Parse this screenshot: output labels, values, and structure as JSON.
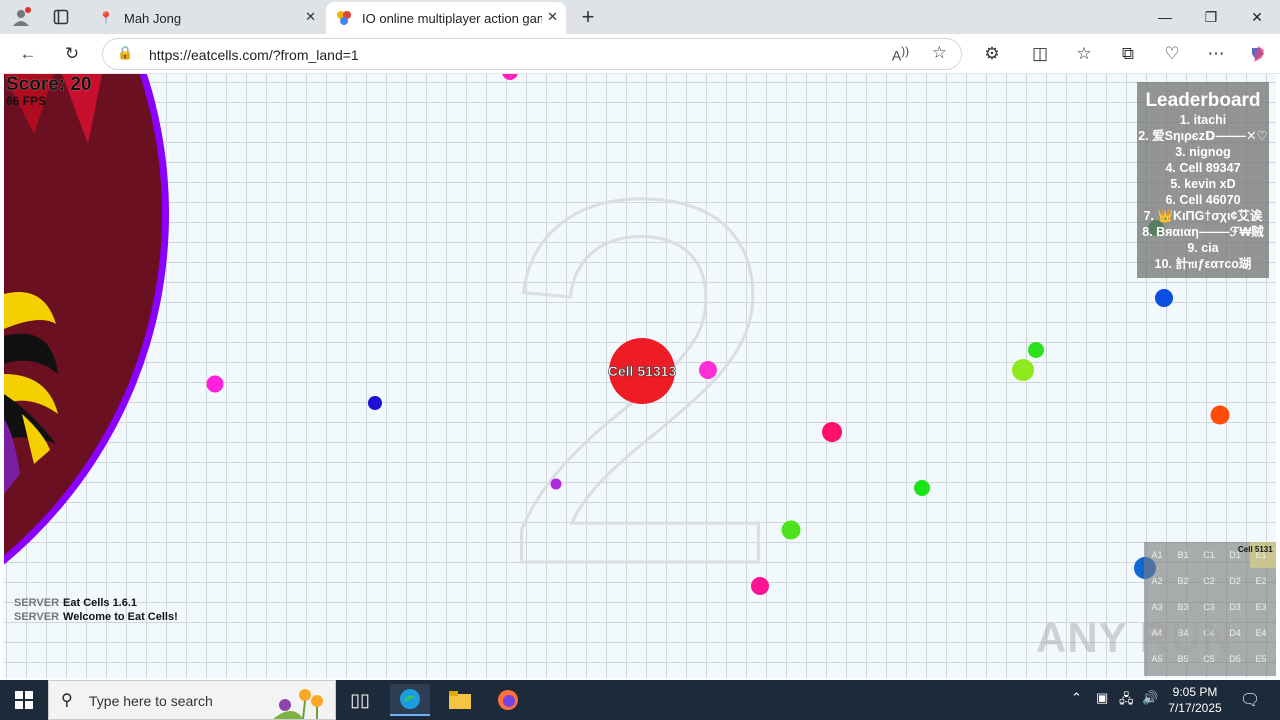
{
  "browser": {
    "tabs": [
      {
        "title": "Mah Jong",
        "favicon": "pin-icon"
      },
      {
        "title": "IO online multiplayer action game",
        "favicon": "colorful-icon"
      }
    ],
    "url": "https://eatcells.com/?from_land=1"
  },
  "game": {
    "score_text": "Score: 20",
    "fps_text": "66 FPS",
    "player_name": "Cell 51313",
    "big_number": "2",
    "leaderboard": {
      "title": "Leaderboard",
      "items": [
        "1. itachi",
        "2. 爱Sηιρєz𝗗⸻✕♡",
        "3. nignog",
        "4. Cell 89347",
        "5. kevin xD",
        "6. Cell 46070",
        "7. 👑KιΠG†σχι¢艾诶",
        "8. Βяαιαη⸻ℱ₩贼",
        "9. cia",
        "10. 計𝔫ιƒεαтco瑚"
      ]
    },
    "chat": [
      {
        "sender": "SERVER",
        "message": "Eat Cells 1.6.1"
      },
      {
        "sender": "SERVER",
        "message": "Welcome to Eat Cells!"
      }
    ],
    "minimap": {
      "cells": [
        "A1",
        "B1",
        "C1",
        "D1",
        "E1",
        "A2",
        "B2",
        "C2",
        "D2",
        "E2",
        "A3",
        "B3",
        "C3",
        "D3",
        "E3",
        "A4",
        "B4",
        "C4",
        "D4",
        "E4",
        "A5",
        "B5",
        "C5",
        "D5",
        "E5"
      ],
      "player_label": "Cell 5131"
    },
    "watermark": "ANY RUN",
    "colors": {
      "player": "#ee1c24",
      "grid": "#cfd7dc",
      "background": "#f2f9fc"
    }
  },
  "taskbar": {
    "search_placeholder": "Type here to search",
    "time": "9:05 PM",
    "date": "7/17/2025"
  }
}
